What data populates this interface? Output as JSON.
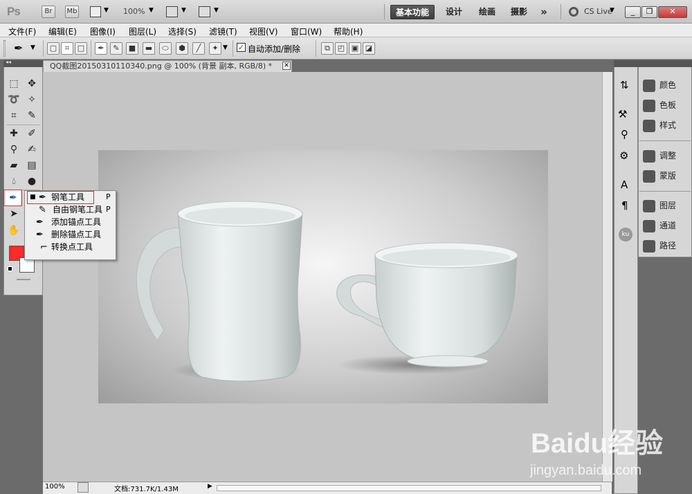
{
  "app": {
    "logo": "Ps",
    "bridge_label": "Br",
    "mini_bridge_label": "Mb",
    "zoom": "100%",
    "cs_live": "CS Live"
  },
  "workspaces": [
    "基本功能",
    "设计",
    "绘画",
    "摄影",
    "»"
  ],
  "menu": [
    "文件(F)",
    "编辑(E)",
    "图像(I)",
    "图层(L)",
    "选择(S)",
    "滤镜(T)",
    "视图(V)",
    "窗口(W)",
    "帮助(H)"
  ],
  "options": {
    "auto_add_delete_label": "自动添加/删除",
    "auto_add_delete_checked": true
  },
  "document": {
    "tab_title": "QQ截图20150310110340.png @ 100% (背景 副本, RGB/8) *",
    "zoom": "100%",
    "doc_size": "文档:731.7K/1.43M"
  },
  "flyout": {
    "items": [
      {
        "label": "钢笔工具",
        "shortcut": "P",
        "selected": true
      },
      {
        "label": "自由钢笔工具",
        "shortcut": "P",
        "selected": false
      },
      {
        "label": "添加锚点工具",
        "shortcut": "",
        "selected": false
      },
      {
        "label": "删除锚点工具",
        "shortcut": "",
        "selected": false
      },
      {
        "label": "转换点工具",
        "shortcut": "",
        "selected": false
      }
    ]
  },
  "panels": {
    "group1": [
      "颜色",
      "色板",
      "样式"
    ],
    "group2": [
      "调整",
      "蒙版"
    ],
    "group3": [
      "图层",
      "通道",
      "路径"
    ]
  },
  "colors": {
    "foreground": "#ff2a2a",
    "background": "#ffffff",
    "highlight_border": "#d23333"
  },
  "watermark": {
    "brand": "Baidu经验",
    "url": "jingyan.baidu.com"
  }
}
